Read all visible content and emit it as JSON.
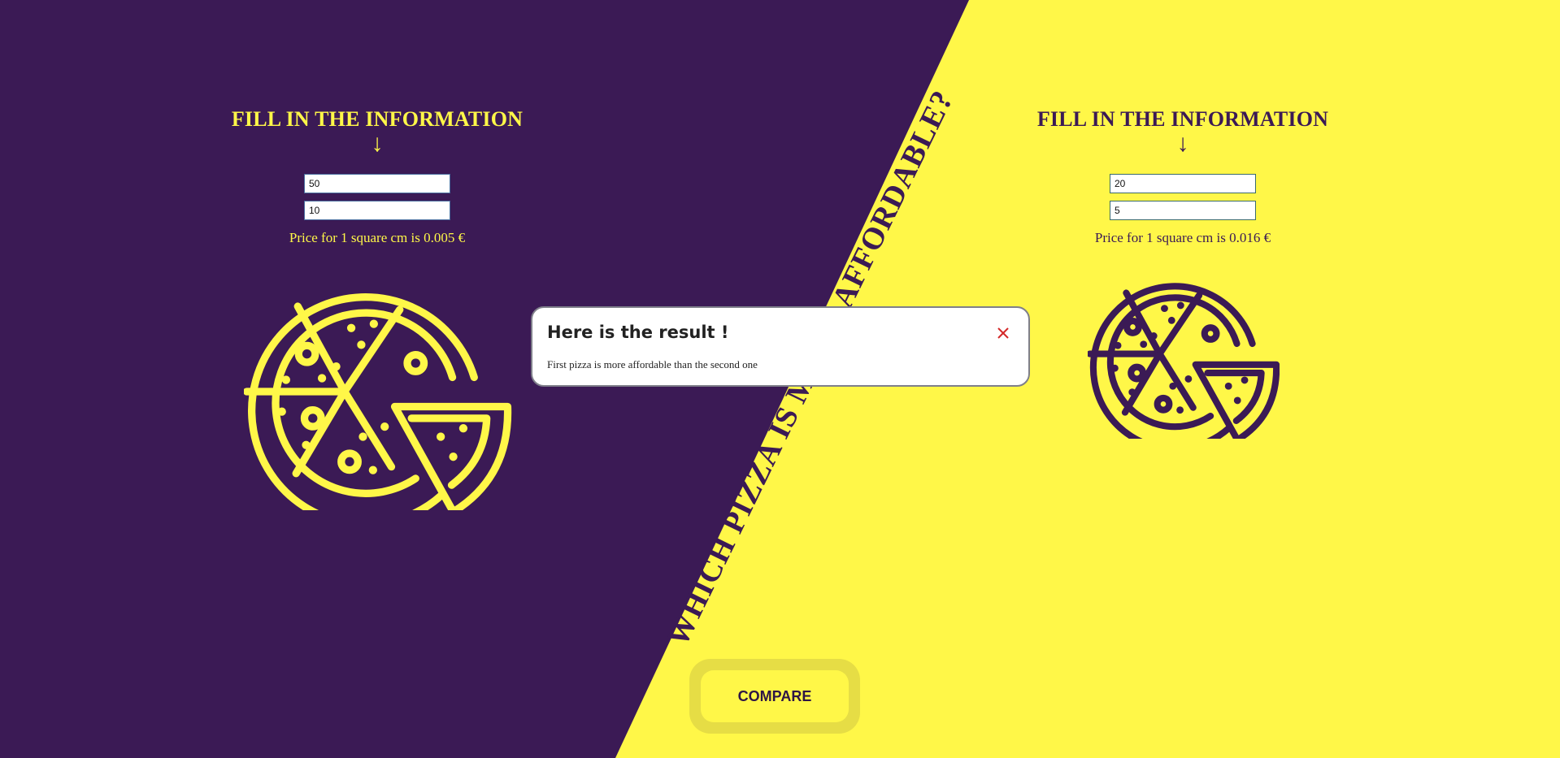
{
  "colors": {
    "purple": "#3b1a55",
    "yellow": "#fff748",
    "close_red": "#d42a2a"
  },
  "left_panel": {
    "title": "FILL IN THE INFORMATION",
    "arrow": "↓",
    "inputs": [
      "50",
      "10"
    ],
    "price_text": "Price for 1 square cm is 0.005 €",
    "pizza_icon": "pizza-icon"
  },
  "right_panel": {
    "title": "FILL IN THE INFORMATION",
    "arrow": "↓",
    "inputs": [
      "20",
      "5"
    ],
    "price_text": "Price for 1 square cm is 0.016 €",
    "pizza_icon": "pizza-icon"
  },
  "headline": "WHICH PIZZA IS MORE AFFORDABLE?",
  "compare_button": "COMPARE",
  "modal": {
    "title": "Here is the result !",
    "message": "First pizza is more affordable than the second one",
    "close_icon": "close-icon"
  }
}
